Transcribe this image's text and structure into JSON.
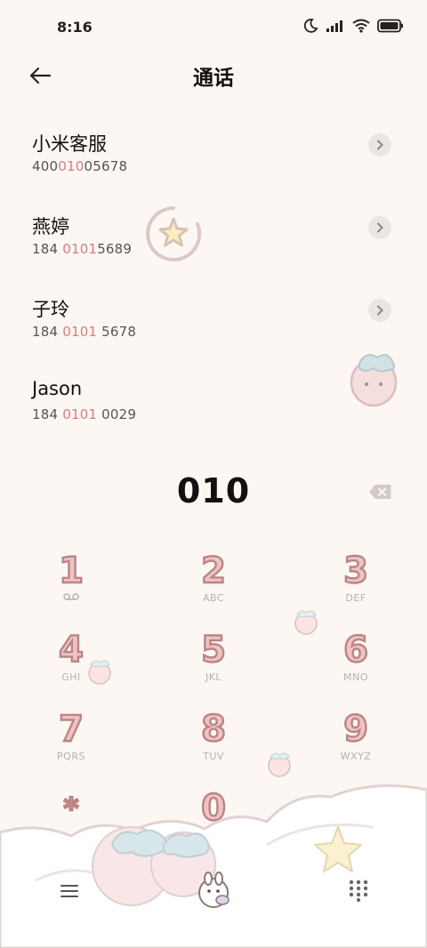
{
  "status_bar": {
    "time": "8:16"
  },
  "header": {
    "title": "通话"
  },
  "contacts": [
    {
      "name": "小米客服",
      "number_pre": "400",
      "number_hl": "010",
      "number_post": "05678"
    },
    {
      "name": "燕婷",
      "number_pre": "184 ",
      "number_hl": "0101",
      "number_post": "5689"
    },
    {
      "name": "子玲",
      "number_pre": "184 ",
      "number_hl": "0101",
      "number_post": " 5678"
    },
    {
      "name": "Jason",
      "number_pre": "184 ",
      "number_hl": "0101",
      "number_post": " 0029"
    }
  ],
  "dial": {
    "input": "010"
  },
  "keypad": [
    {
      "digit": "1",
      "letters": ""
    },
    {
      "digit": "2",
      "letters": "ABC"
    },
    {
      "digit": "3",
      "letters": "DEF"
    },
    {
      "digit": "4",
      "letters": "GHI"
    },
    {
      "digit": "5",
      "letters": "JKL"
    },
    {
      "digit": "6",
      "letters": "MNO"
    },
    {
      "digit": "7",
      "letters": "PQRS"
    },
    {
      "digit": "8",
      "letters": "TUV"
    },
    {
      "digit": "9",
      "letters": "WXYZ"
    },
    {
      "digit": "*",
      "letters": ","
    },
    {
      "digit": "0",
      "letters": "+"
    },
    {
      "digit": "#",
      "letters": ""
    }
  ],
  "colors": {
    "background": "#fdf7f4",
    "highlight": "#e07b7b",
    "key_fill": "#f0c2c2",
    "key_outline": "#b98585"
  },
  "icons": {
    "back": "arrow-left-icon",
    "backspace": "backspace-icon",
    "voicemail": "voicemail-icon",
    "menu": "menu-icon",
    "dialpad": "dialpad-icon"
  }
}
